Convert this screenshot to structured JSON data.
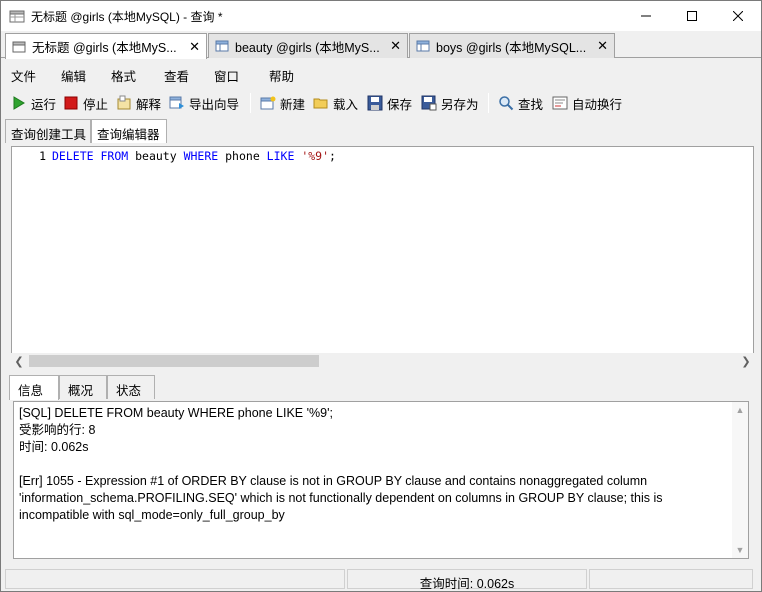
{
  "window": {
    "title": "无标题 @girls (本地MySQL) - 查询 *",
    "icon": "navicat-table-icon"
  },
  "doc_tabs": [
    {
      "label": "无标题 @girls (本地MyS...",
      "active": true,
      "icon": "query-icon"
    },
    {
      "label": "beauty @girls (本地MyS...",
      "active": false,
      "icon": "table-icon"
    },
    {
      "label": "boys @girls (本地MySQL...",
      "active": false,
      "icon": "table-icon"
    }
  ],
  "menu": [
    "文件",
    "编辑",
    "格式",
    "查看",
    "窗口",
    "帮助"
  ],
  "toolbar": {
    "run": "运行",
    "stop": "停止",
    "explain": "解释",
    "export_wizard": "导出向导",
    "new": "新建",
    "load": "载入",
    "save": "保存",
    "save_as": "另存为",
    "find": "查找",
    "word_wrap": "自动换行"
  },
  "sub_tabs": [
    "查询创建工具",
    "查询编辑器"
  ],
  "editor": {
    "line_number": "1",
    "tokens": [
      {
        "t": "DELETE",
        "c": "kw"
      },
      {
        "t": " ",
        "c": ""
      },
      {
        "t": "FROM",
        "c": "kw"
      },
      {
        "t": " beauty ",
        "c": ""
      },
      {
        "t": "WHERE",
        "c": "kw"
      },
      {
        "t": " phone ",
        "c": ""
      },
      {
        "t": "LIKE",
        "c": "kw"
      },
      {
        "t": " ",
        "c": ""
      },
      {
        "t": "'%9'",
        "c": "str"
      },
      {
        "t": ";",
        "c": ""
      }
    ]
  },
  "bottom_tabs": [
    "信息",
    "概况",
    "状态"
  ],
  "messages": "[SQL] DELETE FROM beauty WHERE phone LIKE '%9';\n受影响的行: 8\n时间: 0.062s\n\n[Err] 1055 - Expression #1 of ORDER BY clause is not in GROUP BY clause and contains nonaggregated column 'information_schema.PROFILING.SEQ' which is not functionally dependent on columns in GROUP BY clause; this is incompatible with sql_mode=only_full_group_by",
  "status": {
    "cell1": "",
    "cell2": "查询时间: 0.062s",
    "cell3": ""
  }
}
